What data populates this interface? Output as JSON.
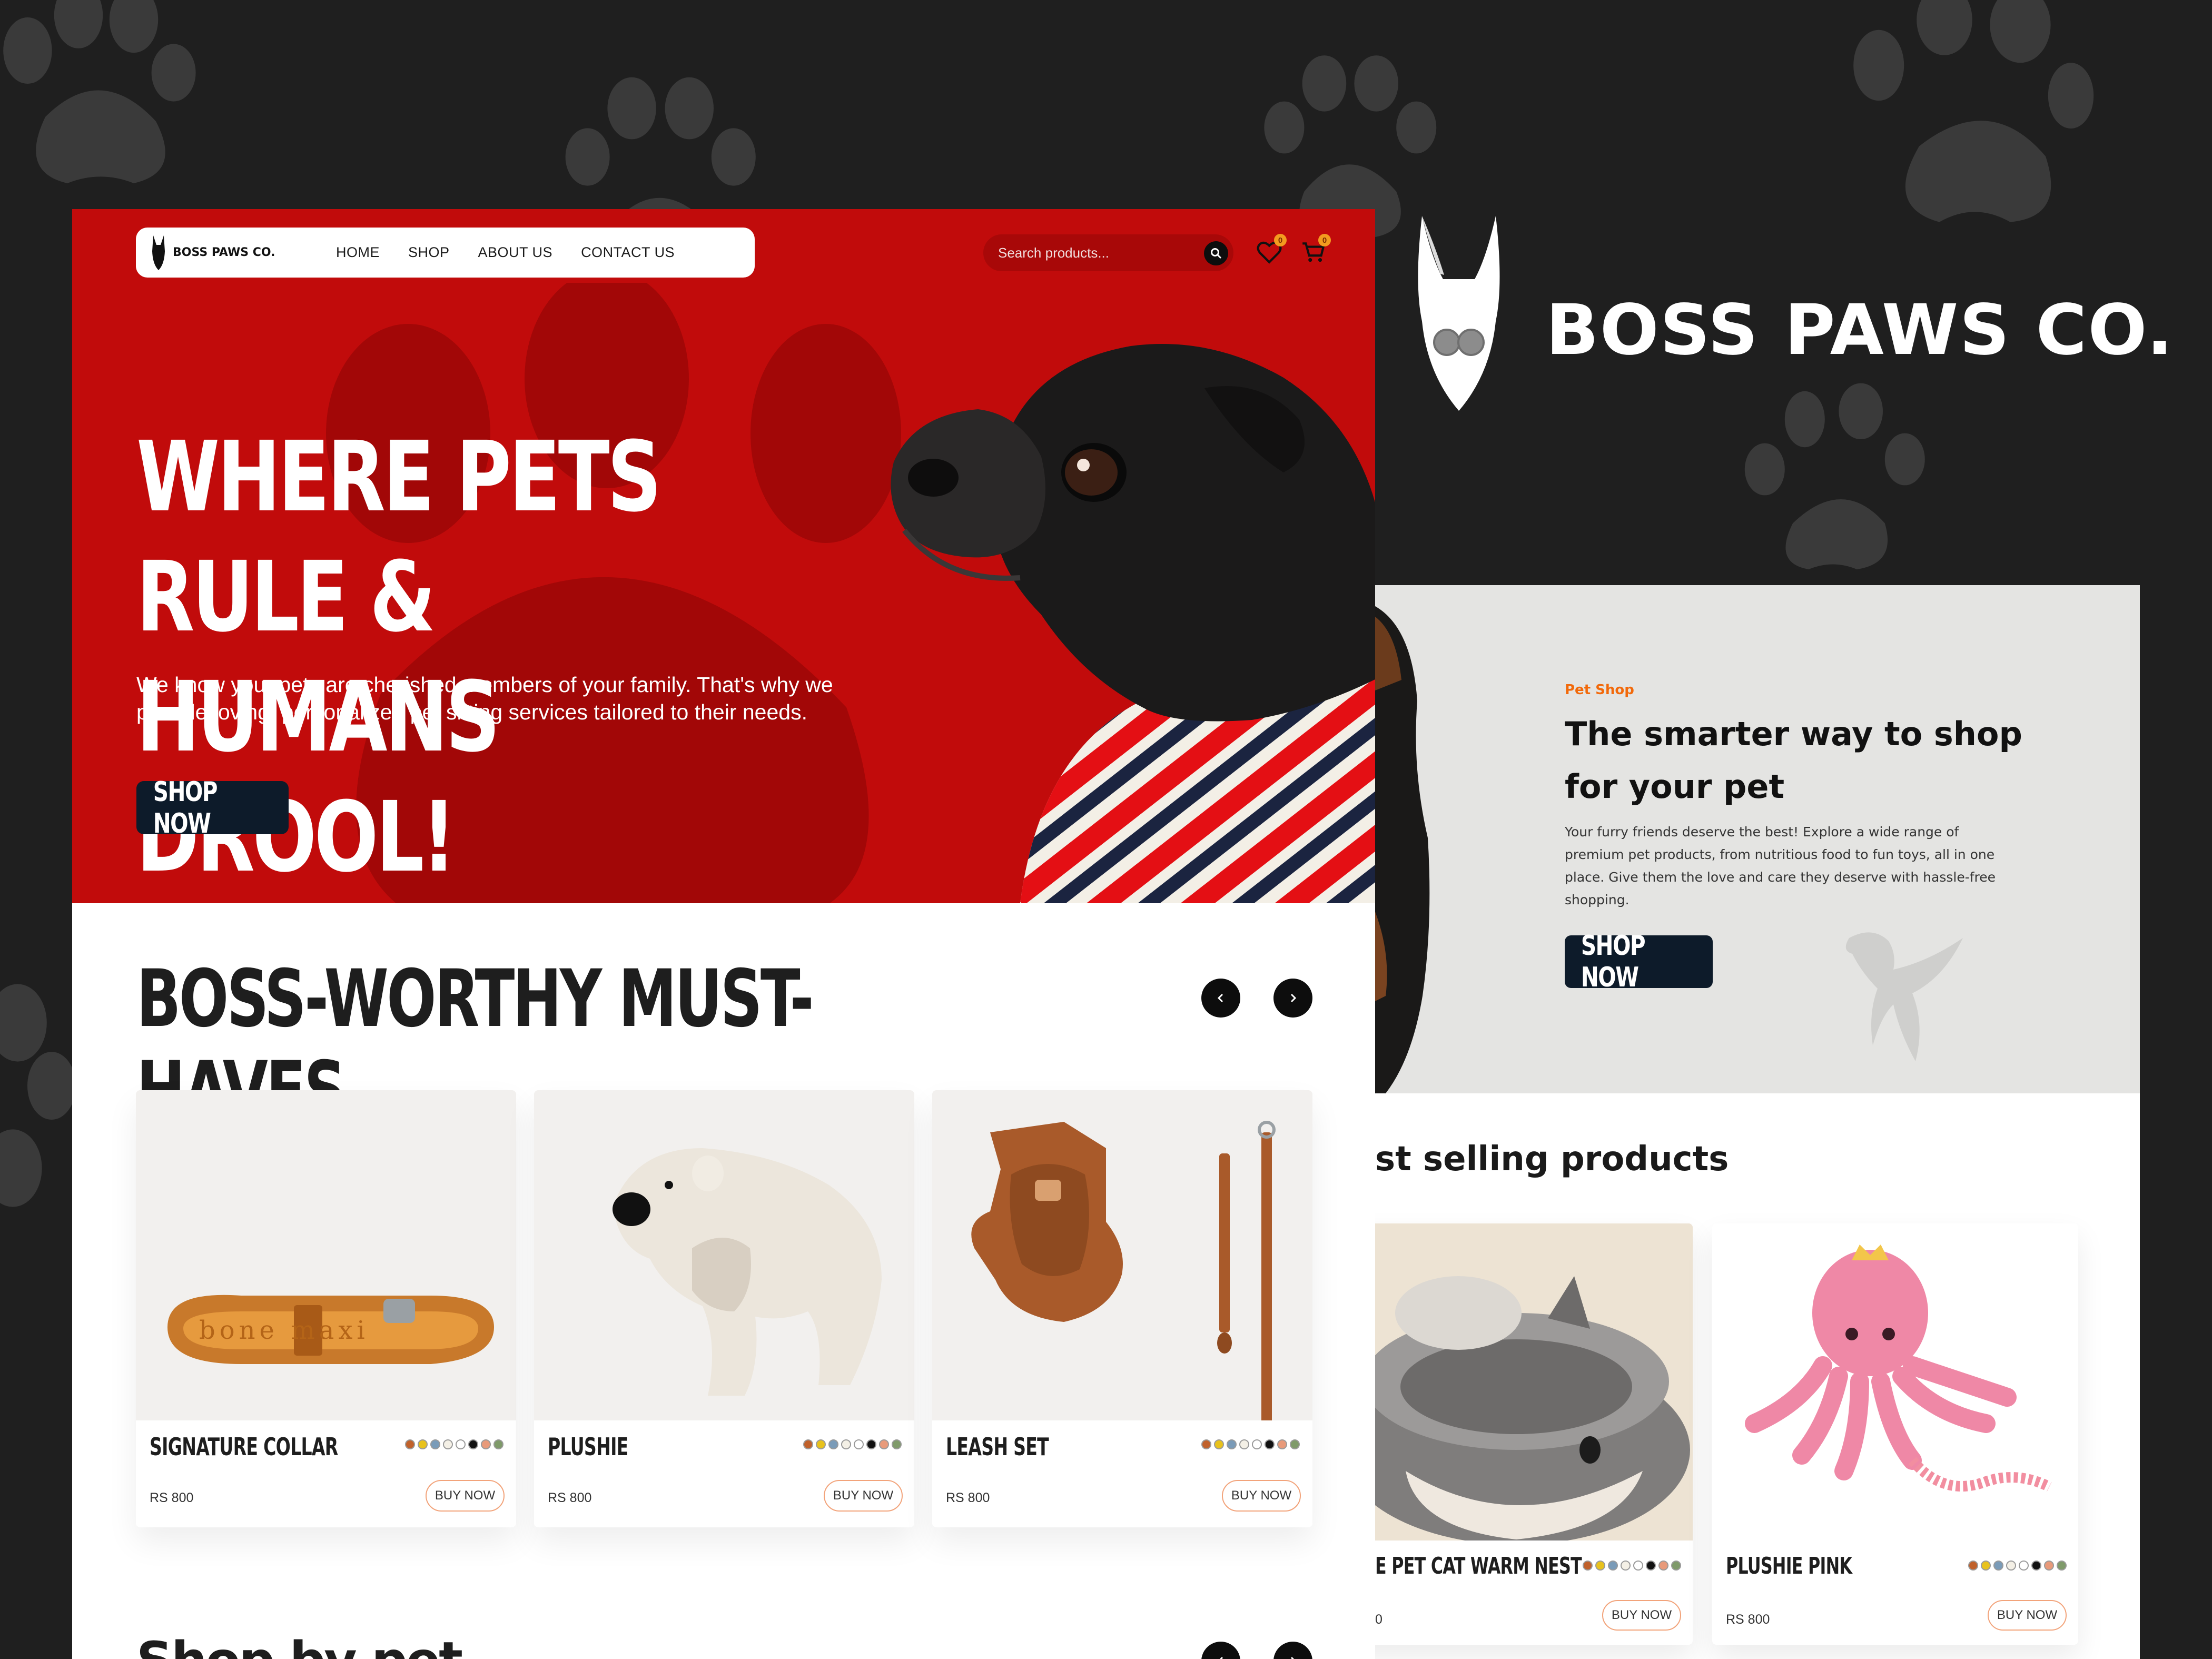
{
  "brand": {
    "name": "BOSS PAWS CO."
  },
  "nav": {
    "logo_text": "BOSS PAWS CO.",
    "items": [
      {
        "label": "HOME"
      },
      {
        "label": "SHOP"
      },
      {
        "label": "ABOUT US"
      },
      {
        "label": "CONTACT US"
      }
    ],
    "search_placeholder": "Search products...",
    "wishlist_count": "0",
    "cart_count": "0"
  },
  "hero": {
    "title_line1": "WHERE PETS RULE &",
    "title_line2": "HUMANS DROOL!",
    "description": "We know your pets are cherished members of your family. That's why we provide loving, personalized pet sitting services tailored to their needs.",
    "cta": "SHOP NOW"
  },
  "featured": {
    "title": "BOSS-WORTHY MUST-HAVES",
    "products": [
      {
        "name": "SIGNATURE COLLAR",
        "price": "RS 800",
        "cta": "BUY NOW"
      },
      {
        "name": "PLUSHIE",
        "price": "RS 800",
        "cta": "BUY NOW"
      },
      {
        "name": "LEASH SET",
        "price": "RS 800",
        "cta": "BUY NOW"
      }
    ]
  },
  "next_section": {
    "title": "Shop by pet"
  },
  "swatch_colors": [
    "#c0612b",
    "#e8c21c",
    "#7a9bb8",
    "#f4f0e6",
    "#ffffff",
    "#111111",
    "#e89a7a",
    "#7f9a6a"
  ],
  "second": {
    "tag": "Pet Shop",
    "title_line1": "The smarter way to shop",
    "title_line2": "for your pet",
    "description": "Your furry friends deserve the best! Explore a wide range of premium pet products, from nutritious food to fun toys, all in one place. Give them the love and care they deserve with hassle-free shopping.",
    "cta": "SHOP NOW",
    "best_title": "st selling products",
    "products": [
      {
        "name": "E PET CAT WARM NEST",
        "price": "0",
        "cta": "BUY NOW"
      },
      {
        "name": "PLUSHIE PINK",
        "price": "RS 800",
        "cta": "BUY NOW"
      }
    ]
  }
}
